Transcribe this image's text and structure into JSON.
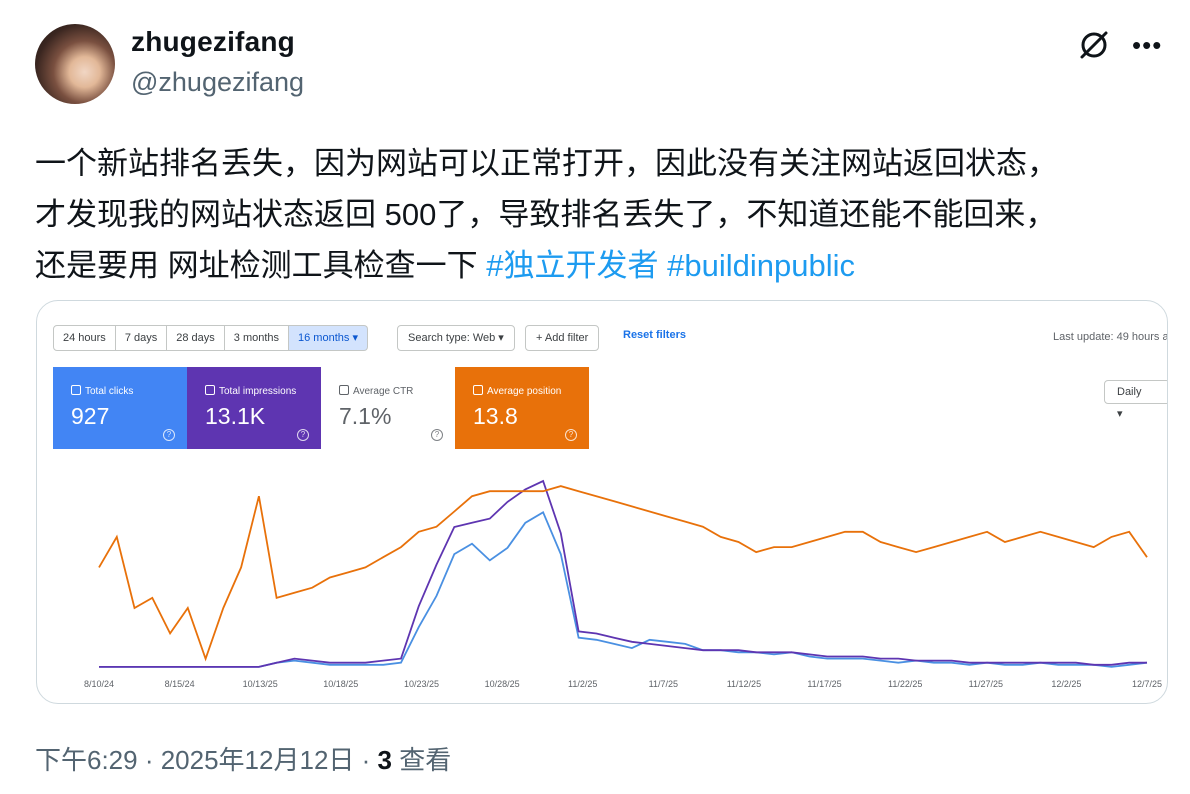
{
  "author": {
    "name": "zhugezifang",
    "handle": "@zhugezifang"
  },
  "tweet": {
    "text": "一个新站排名丢失，因为网站可以正常打开，因此没有关注网站返回状态，\n才发现我的网站状态返回 500了，导致排名丢失了，不知道还能不能回来，\n还是要用 网址检测工具检查一下 ",
    "hashtags": [
      "#独立开发者",
      "#buildinpublic"
    ]
  },
  "console": {
    "ranges": [
      "24 hours",
      "7 days",
      "28 days",
      "3 months",
      "16 months"
    ],
    "selected_range": "16 months",
    "search_type": "Search type: Web",
    "add_filter": "Add filter",
    "reset_filters": "Reset filters",
    "last_update": "Last update: 49 hours a",
    "granularity": "Daily",
    "metrics": [
      {
        "label": "Total clicks",
        "value": "927",
        "color": "#4285f4",
        "checked": true
      },
      {
        "label": "Total impressions",
        "value": "13.1K",
        "color": "#5e35b1",
        "checked": true
      },
      {
        "label": "Average CTR",
        "value": "7.1%",
        "color": "#ffffff",
        "checked": false
      },
      {
        "label": "Average position",
        "value": "13.8",
        "color": "#e8710a",
        "checked": true
      }
    ]
  },
  "chart_data": {
    "type": "line",
    "x_ticks": [
      "8/10/24",
      "8/15/24",
      "10/13/25",
      "10/18/25",
      "10/23/25",
      "10/28/25",
      "11/2/25",
      "11/7/25",
      "11/12/25",
      "11/17/25",
      "11/22/25",
      "11/27/25",
      "12/2/25",
      "12/7/25"
    ],
    "series": [
      {
        "name": "Total clicks",
        "color": "#4a90e2",
        "values": [
          1,
          1,
          1,
          1,
          1,
          1,
          1,
          1,
          1,
          1,
          3,
          4,
          3,
          2,
          2,
          2,
          2,
          3,
          20,
          35,
          55,
          60,
          52,
          58,
          70,
          75,
          55,
          15,
          14,
          12,
          10,
          14,
          13,
          12,
          9,
          9,
          8,
          8,
          7,
          8,
          6,
          5,
          5,
          5,
          4,
          3,
          4,
          3,
          3,
          2,
          3,
          2,
          2,
          3,
          2,
          2,
          2,
          1,
          2,
          3
        ]
      },
      {
        "name": "Total impressions",
        "color": "#5e35b1",
        "values": [
          1,
          1,
          1,
          1,
          1,
          1,
          1,
          1,
          1,
          1,
          3,
          5,
          4,
          3,
          3,
          3,
          4,
          5,
          30,
          50,
          68,
          70,
          72,
          80,
          86,
          90,
          65,
          18,
          17,
          15,
          13,
          12,
          11,
          10,
          9,
          9,
          9,
          8,
          8,
          8,
          7,
          6,
          6,
          6,
          5,
          5,
          4,
          4,
          4,
          3,
          3,
          3,
          3,
          3,
          3,
          3,
          2,
          2,
          3,
          3
        ]
      },
      {
        "name": "Average position",
        "color": "#e8710a",
        "values": [
          22,
          16,
          30,
          28,
          35,
          30,
          40,
          30,
          22,
          8,
          28,
          27,
          26,
          24,
          23,
          22,
          20,
          18,
          15,
          14,
          11,
          8,
          7,
          7,
          7,
          7,
          6,
          7,
          8,
          9,
          10,
          11,
          12,
          13,
          14,
          16,
          17,
          19,
          18,
          18,
          17,
          16,
          15,
          15,
          17,
          18,
          19,
          18,
          17,
          16,
          15,
          17,
          16,
          15,
          16,
          17,
          18,
          16,
          15,
          20
        ]
      }
    ]
  },
  "footer": {
    "time": "下午6:29",
    "date": "2025年12月12日",
    "views": "3",
    "views_label": "查看"
  }
}
